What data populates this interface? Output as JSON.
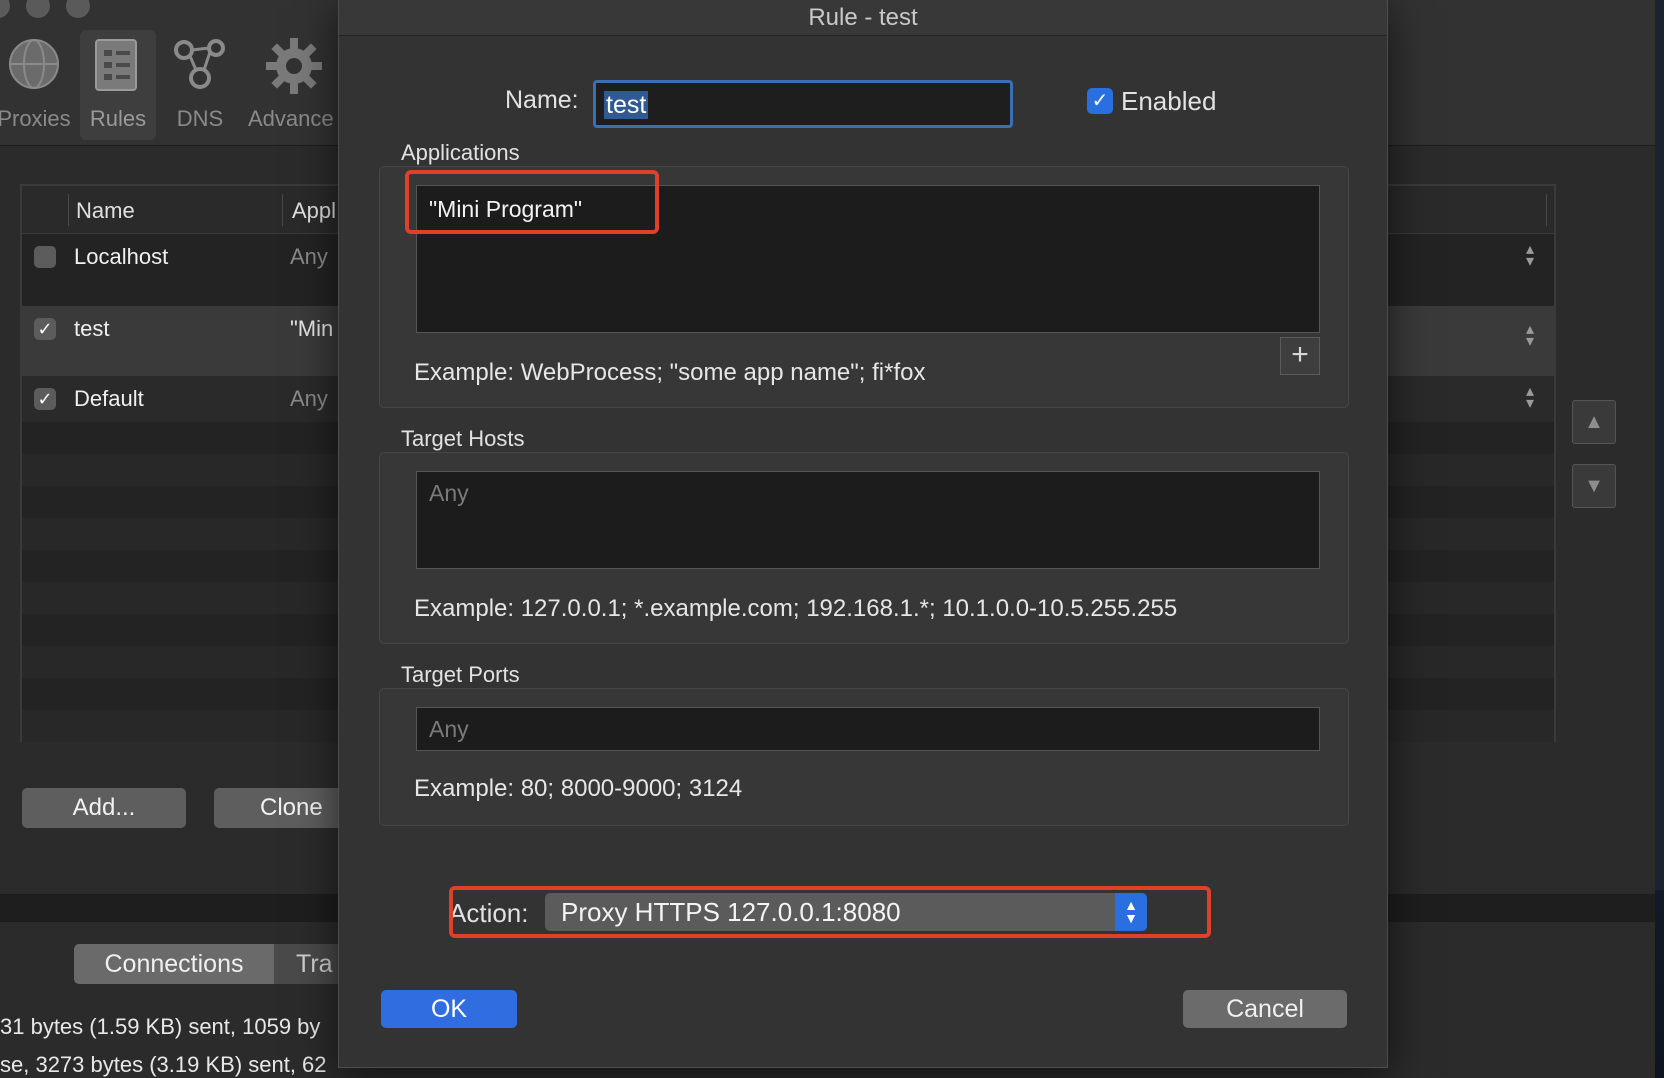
{
  "toolbar": {
    "items": [
      {
        "label": "Proxies",
        "icon": "globe-icon"
      },
      {
        "label": "Rules",
        "icon": "rules-list-icon"
      },
      {
        "label": "DNS",
        "icon": "dns-network-icon"
      },
      {
        "label": "Advance",
        "icon": "gear-icon"
      }
    ]
  },
  "rules_table": {
    "columns": [
      "Name",
      "Appl"
    ],
    "rows": [
      {
        "checked": false,
        "name": "Localhost",
        "app": "Any"
      },
      {
        "checked": true,
        "name": "test",
        "app": "\"Min"
      },
      {
        "checked": true,
        "name": "Default",
        "app": "Any"
      }
    ]
  },
  "bottom_buttons": {
    "add": "Add...",
    "clone": "Clone"
  },
  "tabs": [
    "Connections",
    "Tra"
  ],
  "log_lines": [
    "31 bytes (1.59 KB) sent, 1059 by",
    "se, 3273 bytes (3.19 KB) sent, 62"
  ],
  "dialog": {
    "title": "Rule - test",
    "name_label": "Name:",
    "name_value": "test",
    "enabled_label": "Enabled",
    "enabled_checked": true,
    "applications": {
      "label": "Applications",
      "value": "\"Mini Program\"",
      "example": "Example: WebProcess; \"some app name\"; fi*fox"
    },
    "target_hosts": {
      "label": "Target Hosts",
      "placeholder": "Any",
      "example": "Example: 127.0.0.1; *.example.com; 192.168.1.*; 10.1.0.0-10.5.255.255"
    },
    "target_ports": {
      "label": "Target Ports",
      "placeholder": "Any",
      "example": "Example: 80; 8000-9000; 3124"
    },
    "action_label": "Action:",
    "action_value": "Proxy HTTPS 127.0.0.1:8080",
    "ok_label": "OK",
    "cancel_label": "Cancel"
  },
  "colors": {
    "accent": "#2f6de0",
    "highlight": "#e0402a",
    "dialog_bg": "#333333"
  }
}
